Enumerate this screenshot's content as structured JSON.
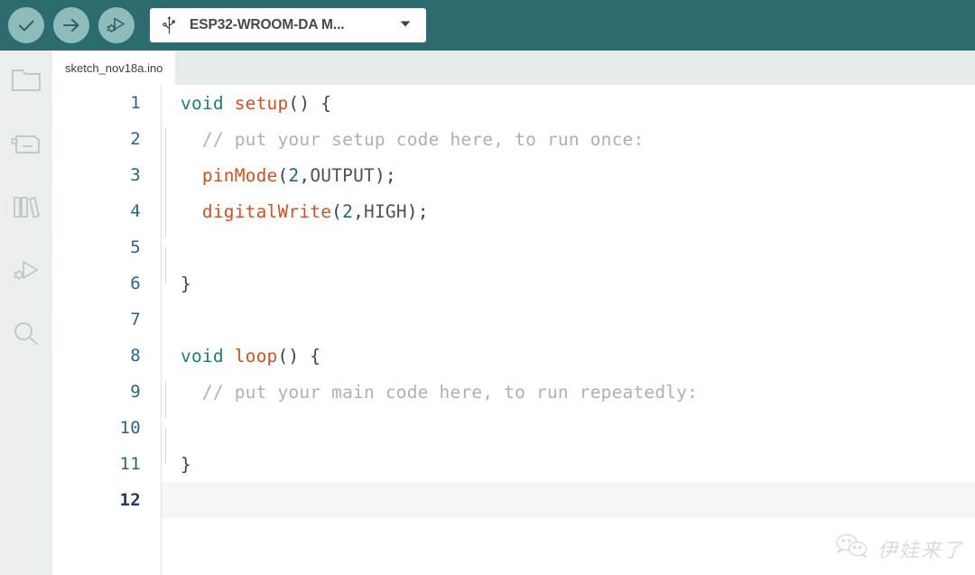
{
  "toolbar": {
    "background_color": "#2e6b71",
    "button_color": "#8dbcba",
    "buttons": [
      {
        "name": "verify",
        "icon": "check-icon",
        "tooltip": "Verify"
      },
      {
        "name": "upload",
        "icon": "arrow-right-icon",
        "tooltip": "Upload"
      },
      {
        "name": "debug",
        "icon": "debug-icon",
        "tooltip": "Debug"
      }
    ],
    "board_selector": {
      "icon": "usb-icon",
      "value": "ESP32-WROOM-DA M...",
      "chevron": "chevron-down-icon"
    }
  },
  "activity_bar": {
    "background_color": "#eceff0",
    "items": [
      {
        "name": "sketchbook",
        "icon": "folder-icon"
      },
      {
        "name": "boards-manager",
        "icon": "board-icon"
      },
      {
        "name": "library-manager",
        "icon": "books-icon"
      },
      {
        "name": "debug",
        "icon": "debug-icon"
      },
      {
        "name": "search",
        "icon": "search-icon"
      }
    ]
  },
  "tabs": {
    "background_color": "#e6ebec",
    "items": [
      {
        "label": "sketch_nov18a.ino",
        "active": true
      }
    ]
  },
  "editor": {
    "active_line": 12,
    "active_line_color": "#f4f5f5",
    "line_number_color": "#2b6584",
    "syntax_colors": {
      "keyword": "#1a7e80",
      "function": "#d0521f",
      "number": "#1a6b73",
      "constant": "#4b5356",
      "comment": "#a9b2b4",
      "punctuation": "#3b4346"
    },
    "lines": [
      {
        "n": "1",
        "indent_guide": false,
        "tokens": [
          {
            "t": "void",
            "c": "kw"
          },
          {
            "t": " ",
            "c": "pn"
          },
          {
            "t": "setup",
            "c": "fn"
          },
          {
            "t": "() {",
            "c": "pn"
          }
        ]
      },
      {
        "n": "2",
        "indent_guide": true,
        "tokens": [
          {
            "t": "  // put your setup code here, to run once:",
            "c": "cmt"
          }
        ]
      },
      {
        "n": "3",
        "indent_guide": true,
        "tokens": [
          {
            "t": "  ",
            "c": "pn"
          },
          {
            "t": "pinMode",
            "c": "fn"
          },
          {
            "t": "(",
            "c": "pn"
          },
          {
            "t": "2",
            "c": "num"
          },
          {
            "t": ",",
            "c": "pn"
          },
          {
            "t": "OUTPUT",
            "c": "cst"
          },
          {
            "t": ");",
            "c": "pn"
          }
        ]
      },
      {
        "n": "4",
        "indent_guide": true,
        "tokens": [
          {
            "t": "  ",
            "c": "pn"
          },
          {
            "t": "digitalWrite",
            "c": "fn"
          },
          {
            "t": "(",
            "c": "pn"
          },
          {
            "t": "2",
            "c": "num"
          },
          {
            "t": ",",
            "c": "pn"
          },
          {
            "t": "HIGH",
            "c": "cst"
          },
          {
            "t": ");",
            "c": "pn"
          }
        ]
      },
      {
        "n": "5",
        "indent_guide": true,
        "tokens": []
      },
      {
        "n": "6",
        "indent_guide": false,
        "tokens": [
          {
            "t": "}",
            "c": "pn"
          }
        ]
      },
      {
        "n": "7",
        "indent_guide": false,
        "tokens": []
      },
      {
        "n": "8",
        "indent_guide": false,
        "tokens": [
          {
            "t": "void",
            "c": "kw"
          },
          {
            "t": " ",
            "c": "pn"
          },
          {
            "t": "loop",
            "c": "fn"
          },
          {
            "t": "() {",
            "c": "pn"
          }
        ]
      },
      {
        "n": "9",
        "indent_guide": true,
        "tokens": [
          {
            "t": "  // put your main code here, to run repeatedly:",
            "c": "cmt"
          }
        ]
      },
      {
        "n": "10",
        "indent_guide": true,
        "tokens": []
      },
      {
        "n": "11",
        "indent_guide": false,
        "tokens": [
          {
            "t": "}",
            "c": "pn"
          }
        ]
      },
      {
        "n": "12",
        "indent_guide": false,
        "tokens": []
      }
    ]
  },
  "watermark": {
    "icon": "wechat-icon",
    "text": "伊娃来了"
  }
}
